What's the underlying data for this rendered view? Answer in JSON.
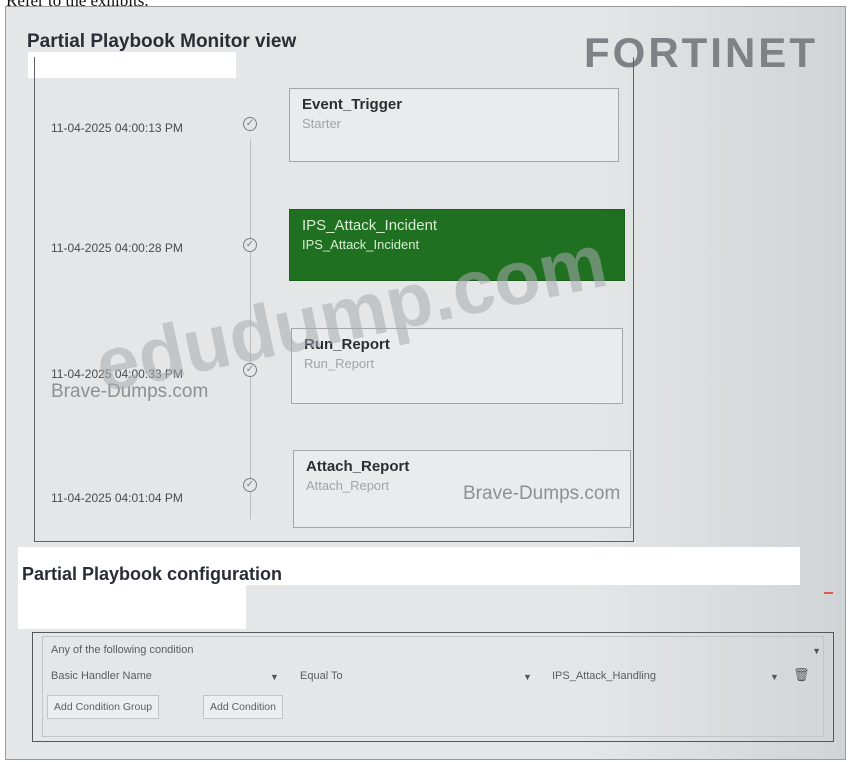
{
  "intro_text": "Refer to the exhibits.",
  "brand_logo": "FORTINET",
  "monitor": {
    "title": "Partial Playbook Monitor view",
    "steps": [
      {
        "timestamp": "11-04-2025 04:00:13 PM",
        "name": "Event_Trigger",
        "subtitle": "Starter",
        "status": "completed"
      },
      {
        "timestamp": "11-04-2025 04:00:28 PM",
        "name": "IPS_Attack_Incident",
        "subtitle": "IPS_Attack_Incident",
        "status": "completed",
        "highlighted": true
      },
      {
        "timestamp": "11-04-2025 04:00:33 PM",
        "name": "Run_Report",
        "subtitle": "Run_Report",
        "status": "completed"
      },
      {
        "timestamp": "11-04-2025 04:01:04 PM",
        "name": "Attach_Report",
        "subtitle": "Attach_Report",
        "status": "completed"
      }
    ]
  },
  "configuration": {
    "title": "Partial Playbook configuration",
    "match_mode": "Any of the following condition",
    "condition": {
      "field": "Basic Handler Name",
      "operator": "Equal To",
      "value": "IPS_Attack_Handling"
    },
    "buttons": {
      "add_group": "Add Condition Group",
      "add_condition": "Add Condition"
    }
  },
  "watermarks": {
    "main": "edudump.com",
    "secondary_1": "Brave-Dumps.com",
    "secondary_2": "Brave-Dumps.com"
  },
  "colors": {
    "highlight_green": "#1f7020",
    "background": "#e4e6e7"
  }
}
